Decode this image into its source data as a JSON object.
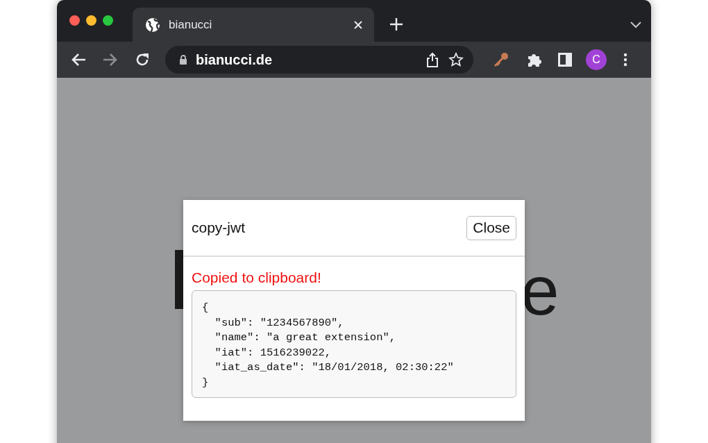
{
  "browser": {
    "tabs": [
      {
        "title": "bianucci",
        "selected": true
      }
    ],
    "address": "bianucci.de",
    "profile_initial": "C"
  },
  "page": {
    "fragment_right": "e"
  },
  "dialog": {
    "title": "copy-jwt",
    "close_label": "Close",
    "status": "Copied to clipboard!",
    "code_lines": [
      "{",
      "  \"sub\": \"1234567890\",",
      "  \"name\": \"a great extension\",",
      "  \"iat\": 1516239022,",
      "  \"iat_as_date\": \"18/01/2018, 02:30:22\"",
      "}"
    ]
  }
}
